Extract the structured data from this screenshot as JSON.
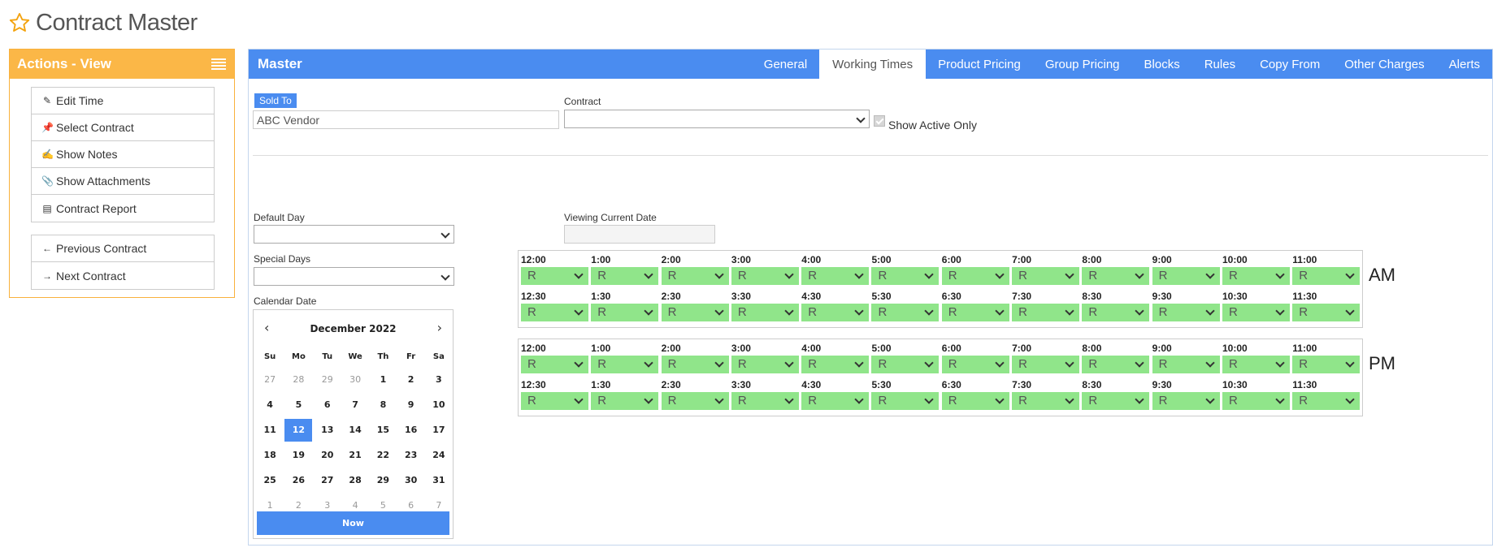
{
  "page": {
    "title": "Contract Master"
  },
  "actions": {
    "title": "Actions - View",
    "buttons": [
      {
        "label": "Edit Time",
        "icon": "pencil-icon"
      },
      {
        "label": "Select Contract",
        "icon": "pin-icon"
      },
      {
        "label": "Show Notes",
        "icon": "edit-note-icon"
      },
      {
        "label": "Show Attachments",
        "icon": "paperclip-icon"
      },
      {
        "label": "Contract Report",
        "icon": "document-icon"
      }
    ],
    "nav_buttons": [
      {
        "label": "Previous Contract",
        "icon": "arrow-left-icon"
      },
      {
        "label": "Next Contract",
        "icon": "arrow-right-icon"
      }
    ]
  },
  "main": {
    "title": "Master",
    "tabs": [
      {
        "label": "General",
        "active": false
      },
      {
        "label": "Working Times",
        "active": true
      },
      {
        "label": "Product Pricing",
        "active": false
      },
      {
        "label": "Group Pricing",
        "active": false
      },
      {
        "label": "Blocks",
        "active": false
      },
      {
        "label": "Rules",
        "active": false
      },
      {
        "label": "Copy From",
        "active": false
      },
      {
        "label": "Other Charges",
        "active": false
      },
      {
        "label": "Alerts",
        "active": false
      }
    ]
  },
  "form": {
    "sold_to_label": "Sold To",
    "sold_to_value": "ABC Vendor",
    "contract_label": "Contract",
    "contract_value": "",
    "show_active_label": "Show Active Only",
    "show_active_checked": true,
    "default_day_label": "Default Day",
    "special_days_label": "Special Days",
    "calendar_date_label": "Calendar Date",
    "viewing_date_label": "Viewing Current Date",
    "viewing_date_value": ""
  },
  "calendar": {
    "month": "December 2022",
    "weekdays": [
      "Su",
      "Mo",
      "Tu",
      "We",
      "Th",
      "Fr",
      "Sa"
    ],
    "weeks": [
      [
        "27",
        "28",
        "29",
        "30",
        "1",
        "2",
        "3"
      ],
      [
        "4",
        "5",
        "6",
        "7",
        "8",
        "9",
        "10"
      ],
      [
        "11",
        "12",
        "13",
        "14",
        "15",
        "16",
        "17"
      ],
      [
        "18",
        "19",
        "20",
        "21",
        "22",
        "23",
        "24"
      ],
      [
        "25",
        "26",
        "27",
        "28",
        "29",
        "30",
        "31"
      ],
      [
        "1",
        "2",
        "3",
        "4",
        "5",
        "6",
        "7"
      ]
    ],
    "selected": "12",
    "now_label": "Now"
  },
  "times": {
    "am_label": "AM",
    "pm_label": "PM",
    "hours": [
      "12:00",
      "1:00",
      "2:00",
      "3:00",
      "4:00",
      "5:00",
      "6:00",
      "7:00",
      "8:00",
      "9:00",
      "10:00",
      "11:00"
    ],
    "halves": [
      "12:30",
      "1:30",
      "2:30",
      "3:30",
      "4:30",
      "5:30",
      "6:30",
      "7:30",
      "8:30",
      "9:30",
      "10:30",
      "11:30"
    ],
    "slot_value": "R",
    "slot_color": "#90e58a"
  },
  "colors": {
    "accent": "#4a8cf0",
    "actions_header": "#fbb747"
  }
}
